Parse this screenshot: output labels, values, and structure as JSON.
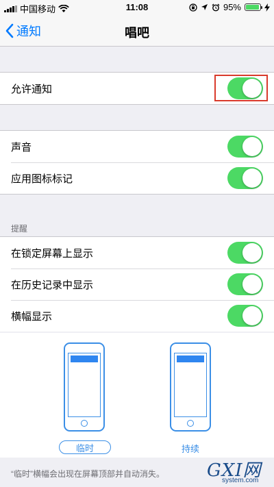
{
  "status_bar": {
    "carrier": "中国移动",
    "time": "11:08",
    "battery_percent": "95%",
    "battery_level": 0.95
  },
  "nav": {
    "back_label": "通知",
    "title": "唱吧"
  },
  "allow_group": {
    "label": "允许通知",
    "on": true
  },
  "settings_group": {
    "sounds_label": "声音",
    "badge_label": "应用图标标记"
  },
  "alerts": {
    "header": "提醒",
    "lock_screen_label": "在锁定屏幕上显示",
    "history_label": "在历史记录中显示",
    "banners_label": "横幅显示"
  },
  "banner_styles": {
    "temporary_label": "临时",
    "persistent_label": "持续",
    "selected": "临时"
  },
  "footer_note": "“临时”横幅会出现在屏幕顶部并自动消失。",
  "watermark": {
    "main": "GXI网",
    "sub": "system.com"
  },
  "colors": {
    "toggle_on": "#4cd964",
    "accent": "#007aff",
    "highlight": "#d93a2b"
  }
}
